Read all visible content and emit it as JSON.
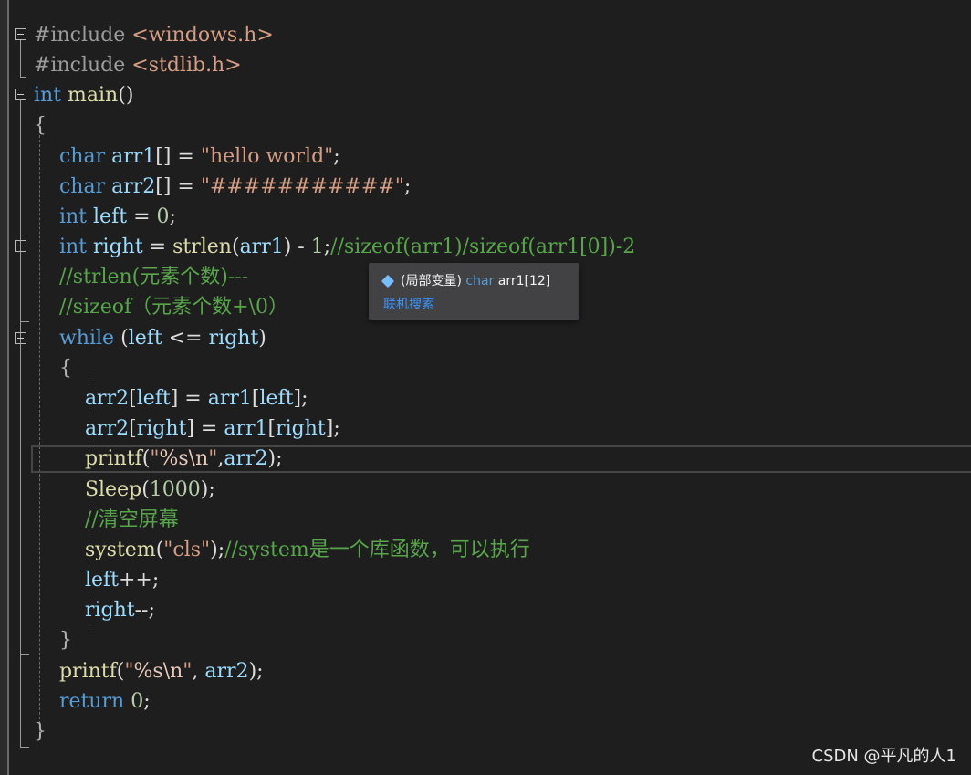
{
  "code": {
    "lines": [
      {
        "id": "l1",
        "tokens": [
          {
            "t": "#include ",
            "c": "pp"
          },
          {
            "t": "<windows.h>",
            "c": "str"
          }
        ]
      },
      {
        "id": "l2",
        "tokens": [
          {
            "t": "#include ",
            "c": "pp"
          },
          {
            "t": "<stdlib.h>",
            "c": "str"
          }
        ]
      },
      {
        "id": "l3",
        "tokens": [
          {
            "t": "int",
            "c": "kw"
          },
          {
            "t": " main",
            "c": "fn"
          },
          {
            "t": "()",
            "c": ""
          }
        ]
      },
      {
        "id": "l4",
        "tokens": [
          {
            "t": "{",
            "c": "op"
          }
        ]
      },
      {
        "id": "l5",
        "tokens": [
          {
            "t": "    char",
            "c": "kw"
          },
          {
            "t": " arr1",
            "c": "vr"
          },
          {
            "t": "[] = ",
            "c": ""
          },
          {
            "t": "\"hello world\"",
            "c": "str"
          },
          {
            "t": ";",
            "c": ""
          }
        ]
      },
      {
        "id": "l6",
        "tokens": [
          {
            "t": "    char",
            "c": "kw"
          },
          {
            "t": " arr2",
            "c": "vr"
          },
          {
            "t": "[] = ",
            "c": ""
          },
          {
            "t": "\"###########\"",
            "c": "str"
          },
          {
            "t": ";",
            "c": ""
          }
        ]
      },
      {
        "id": "l7",
        "tokens": [
          {
            "t": "    int",
            "c": "kw"
          },
          {
            "t": " left",
            "c": "vr"
          },
          {
            "t": " = ",
            "c": ""
          },
          {
            "t": "0",
            "c": "num"
          },
          {
            "t": ";",
            "c": ""
          }
        ]
      },
      {
        "id": "l8",
        "tokens": [
          {
            "t": "    int",
            "c": "kw"
          },
          {
            "t": " right",
            "c": "vr"
          },
          {
            "t": " = ",
            "c": ""
          },
          {
            "t": "strlen",
            "c": "fn"
          },
          {
            "t": "(",
            "c": ""
          },
          {
            "t": "arr1",
            "c": "vr"
          },
          {
            "t": ") - ",
            "c": ""
          },
          {
            "t": "1",
            "c": "num"
          },
          {
            "t": ";",
            "c": ""
          },
          {
            "t": "//sizeof(arr1)/sizeof(arr1[0])-2",
            "c": "cm"
          }
        ]
      },
      {
        "id": "l9",
        "tokens": [
          {
            "t": "    //strlen(元素个数)---",
            "c": "cm"
          }
        ]
      },
      {
        "id": "l10",
        "tokens": [
          {
            "t": "    //sizeof（元素个数+\\0）",
            "c": "cm"
          }
        ]
      },
      {
        "id": "l11",
        "tokens": [
          {
            "t": "    while",
            "c": "kw"
          },
          {
            "t": " (",
            "c": ""
          },
          {
            "t": "left",
            "c": "vr"
          },
          {
            "t": " <= ",
            "c": ""
          },
          {
            "t": "right",
            "c": "vr"
          },
          {
            "t": ")",
            "c": ""
          }
        ]
      },
      {
        "id": "l12",
        "tokens": [
          {
            "t": "    {",
            "c": "op"
          }
        ]
      },
      {
        "id": "l13",
        "tokens": [
          {
            "t": "        arr2",
            "c": "vr"
          },
          {
            "t": "[",
            "c": ""
          },
          {
            "t": "left",
            "c": "vr"
          },
          {
            "t": "] = ",
            "c": ""
          },
          {
            "t": "arr1",
            "c": "vr"
          },
          {
            "t": "[",
            "c": ""
          },
          {
            "t": "left",
            "c": "vr"
          },
          {
            "t": "];",
            "c": ""
          }
        ]
      },
      {
        "id": "l14",
        "tokens": [
          {
            "t": "        arr2",
            "c": "vr"
          },
          {
            "t": "[",
            "c": ""
          },
          {
            "t": "right",
            "c": "vr"
          },
          {
            "t": "] = ",
            "c": ""
          },
          {
            "t": "arr1",
            "c": "vr"
          },
          {
            "t": "[",
            "c": ""
          },
          {
            "t": "right",
            "c": "vr"
          },
          {
            "t": "];",
            "c": ""
          }
        ]
      },
      {
        "id": "l15",
        "tokens": [
          {
            "t": "        printf",
            "c": "fn"
          },
          {
            "t": "(",
            "c": ""
          },
          {
            "t": "\"",
            "c": "str"
          },
          {
            "t": "%s",
            "c": "esc"
          },
          {
            "t": "\\n",
            "c": "esc"
          },
          {
            "t": "\"",
            "c": "str"
          },
          {
            "t": ",",
            "c": ""
          },
          {
            "t": "arr2",
            "c": "vr"
          },
          {
            "t": ");",
            "c": ""
          }
        ]
      },
      {
        "id": "l16",
        "tokens": [
          {
            "t": "        Sleep",
            "c": "fn"
          },
          {
            "t": "(",
            "c": ""
          },
          {
            "t": "1000",
            "c": "num"
          },
          {
            "t": ");",
            "c": ""
          }
        ]
      },
      {
        "id": "l17",
        "tokens": [
          {
            "t": "        //清空屏幕",
            "c": "cm"
          }
        ]
      },
      {
        "id": "l18",
        "tokens": [
          {
            "t": "        system",
            "c": "fn"
          },
          {
            "t": "(",
            "c": ""
          },
          {
            "t": "\"cls\"",
            "c": "str"
          },
          {
            "t": ");",
            "c": ""
          },
          {
            "t": "//system是一个库函数，可以执行",
            "c": "cm"
          }
        ]
      },
      {
        "id": "l19",
        "tokens": [
          {
            "t": "        left",
            "c": "vr"
          },
          {
            "t": "++;",
            "c": ""
          }
        ]
      },
      {
        "id": "l20",
        "tokens": [
          {
            "t": "        right",
            "c": "vr"
          },
          {
            "t": "--;",
            "c": ""
          }
        ]
      },
      {
        "id": "l21",
        "tokens": [
          {
            "t": "    }",
            "c": "op"
          }
        ]
      },
      {
        "id": "l22",
        "tokens": [
          {
            "t": "    printf",
            "c": "fn"
          },
          {
            "t": "(",
            "c": ""
          },
          {
            "t": "\"",
            "c": "str"
          },
          {
            "t": "%s",
            "c": "esc"
          },
          {
            "t": "\\n",
            "c": "esc"
          },
          {
            "t": "\"",
            "c": "str"
          },
          {
            "t": ", ",
            "c": ""
          },
          {
            "t": "arr2",
            "c": "vr"
          },
          {
            "t": ");",
            "c": ""
          }
        ]
      },
      {
        "id": "l23",
        "tokens": [
          {
            "t": "    return",
            "c": "kw"
          },
          {
            "t": " ",
            "c": ""
          },
          {
            "t": "0",
            "c": "num"
          },
          {
            "t": ";",
            "c": ""
          }
        ]
      },
      {
        "id": "l24",
        "tokens": [
          {
            "t": "}",
            "c": "op"
          }
        ]
      }
    ]
  },
  "tooltip": {
    "icon": "local-variable-icon",
    "scope": "(局部变量)",
    "type": "char",
    "name": "arr1[12]",
    "link": "联机搜索"
  },
  "watermark": "CSDN @平凡的人1"
}
